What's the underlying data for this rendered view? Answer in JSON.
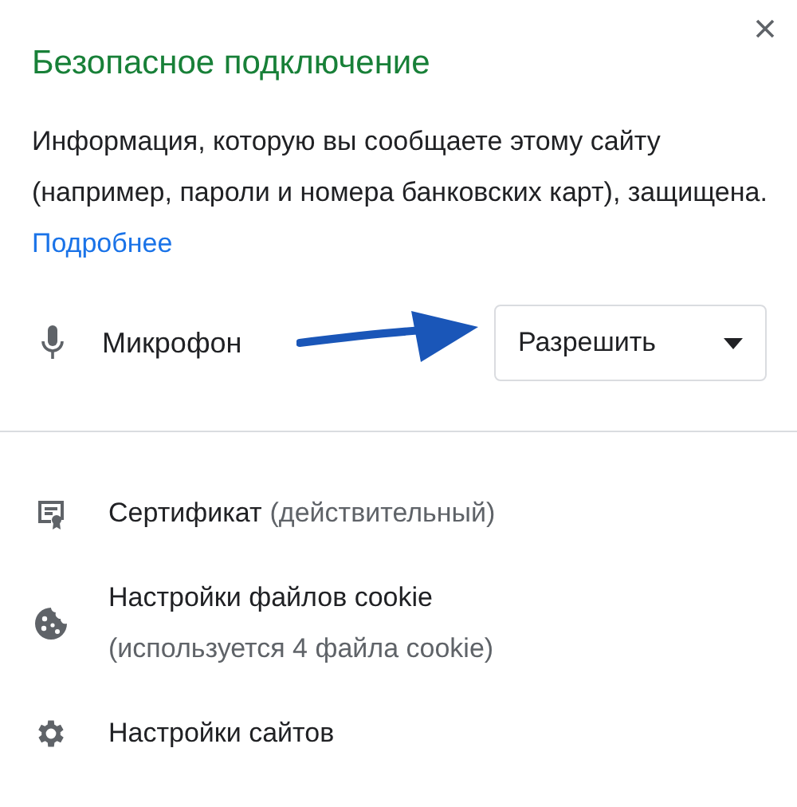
{
  "title": "Безопасное подключение",
  "description": {
    "text": "Информация, которую вы сообщаете этому сайту (например, пароли и номера банковских карт), защищена.",
    "link": "Подробнее"
  },
  "permission": {
    "label": "Микрофон",
    "value": "Разрешить"
  },
  "items": [
    {
      "kind": "certificate",
      "label": "Сертификат",
      "detail": "(действительный)"
    },
    {
      "kind": "cookie",
      "label": "Настройки файлов cookie",
      "subtitle": "(используется 4 файла cookie)"
    },
    {
      "kind": "settings",
      "label": "Настройки сайтов"
    }
  ]
}
